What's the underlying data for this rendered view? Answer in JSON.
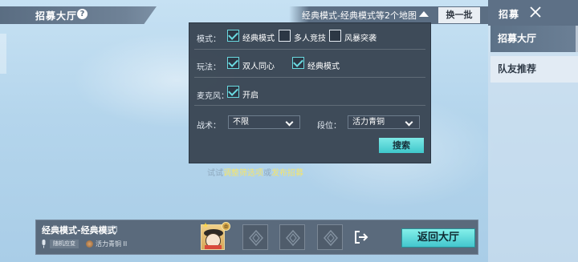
{
  "header": {
    "title": "招募大厅",
    "help_icon": "question-icon",
    "filter_summary": "经典模式-经典模式等2个地图",
    "swap_label": "换一批"
  },
  "right_panel": {
    "title": "招募",
    "tabs": [
      {
        "label": "招募大厅",
        "active": true
      },
      {
        "label": "队友推荐",
        "active": false
      }
    ]
  },
  "filter": {
    "mode_label": "模式：",
    "modes": [
      {
        "label": "经典模式",
        "checked": true
      },
      {
        "label": "多人竞技",
        "checked": false
      },
      {
        "label": "风暴突袭",
        "checked": false
      }
    ],
    "play_label": "玩法：",
    "plays": [
      {
        "label": "双人同心",
        "checked": true
      },
      {
        "label": "经典模式",
        "checked": true
      }
    ],
    "mic_label": "麦克风：",
    "mic": {
      "label": "开启",
      "checked": true
    },
    "tactic_label": "战术：",
    "tactic_value": "不限",
    "rank_label": "段位：",
    "rank_value": "活力青铜",
    "search_label": "搜索"
  },
  "hint": {
    "prefix": "试试",
    "link1": "调整筛选项",
    "middle": "或",
    "link2": "发布招募"
  },
  "team_bar": {
    "mode": "经典模式-经典模式",
    "mic_badge": "随机应变",
    "rank_text": "活力青铜 II",
    "empty_slots": 3,
    "return_label": "返回大厅"
  },
  "colors": {
    "accent": "#52d4d8",
    "panel": "#3a4654",
    "highlight_text": "#f5e56b"
  }
}
